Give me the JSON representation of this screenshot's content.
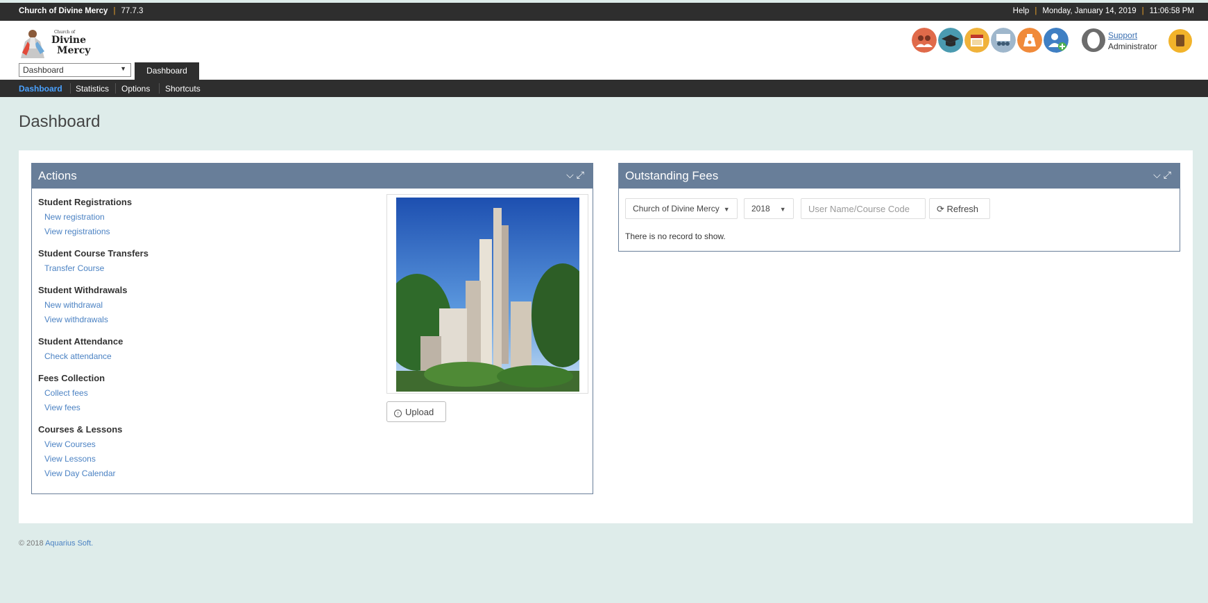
{
  "topbar": {
    "church": "Church of Divine Mercy",
    "version": "77.7.3",
    "help": "Help",
    "date": "Monday, January 14, 2019",
    "time": "11:06:58 PM"
  },
  "logo": {
    "line1": "Church of",
    "line2": "Divine",
    "line3": "Mercy"
  },
  "module_select": {
    "value": "Dashboard"
  },
  "active_tab": "Dashboard",
  "nav_icons": [
    {
      "name": "members-icon",
      "color": "#e06a4a"
    },
    {
      "name": "graduation-icon",
      "color": "#4a9ab0"
    },
    {
      "name": "calendar-icon",
      "color": "#f0b23a"
    },
    {
      "name": "class-icon",
      "color": "#9fb7cc"
    },
    {
      "name": "fees-bag-icon",
      "color": "#f08a3a"
    },
    {
      "name": "add-user-icon",
      "color": "#3f7fc3"
    }
  ],
  "user": {
    "support_link": "Support",
    "role": "Administrator"
  },
  "subnav": [
    "Dashboard",
    "Statistics",
    "Options",
    "Shortcuts"
  ],
  "page_title": "Dashboard",
  "actions_panel": {
    "title": "Actions",
    "sections": [
      {
        "title": "Student Registrations",
        "links": [
          "New registration",
          "View registrations"
        ]
      },
      {
        "title": "Student Course Transfers",
        "links": [
          "Transfer Course"
        ]
      },
      {
        "title": "Student Withdrawals",
        "links": [
          "New withdrawal",
          "View withdrawals"
        ]
      },
      {
        "title": "Student Attendance",
        "links": [
          "Check attendance"
        ]
      },
      {
        "title": "Fees Collection",
        "links": [
          "Collect fees",
          "View fees"
        ]
      },
      {
        "title": "Courses & Lessons",
        "links": [
          "View Courses",
          "View Lessons",
          "View Day Calendar"
        ]
      }
    ],
    "upload_label": "Upload"
  },
  "fees_panel": {
    "title": "Outstanding Fees",
    "church_select": "Church of Divine Mercy",
    "year_select": "2018",
    "search_placeholder": "User Name/Course Code",
    "refresh_label": "Refresh",
    "empty_message": "There is no record to show."
  },
  "footer": {
    "copyright": "© 2018",
    "company": "Aquarius Soft."
  }
}
